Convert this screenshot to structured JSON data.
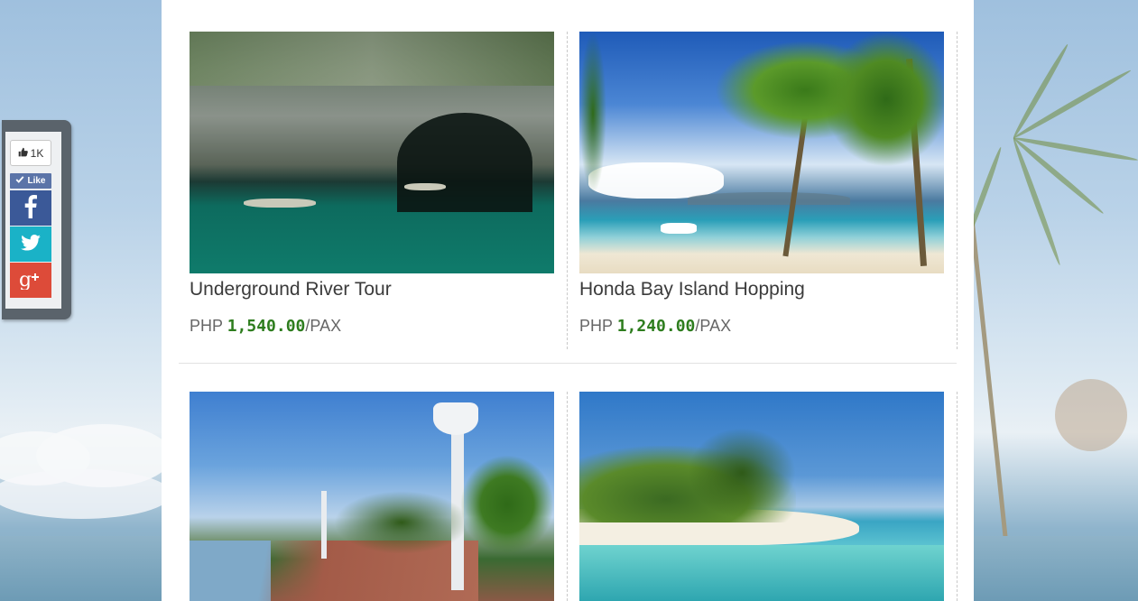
{
  "share_widget": {
    "like_count": "1K",
    "like_label": "Like",
    "buttons": [
      {
        "name": "facebook",
        "color": "#3b5998"
      },
      {
        "name": "twitter",
        "color": "#1ab2c7"
      },
      {
        "name": "google-plus",
        "color": "#dd4b39"
      }
    ]
  },
  "tours": [
    {
      "title": "Underground River Tour",
      "currency": "PHP",
      "amount": "1,540.00",
      "unit": "/PAX"
    },
    {
      "title": "Honda Bay Island Hopping",
      "currency": "PHP",
      "amount": "1,240.00",
      "unit": "/PAX"
    },
    {
      "title": "",
      "currency": "",
      "amount": "",
      "unit": ""
    },
    {
      "title": "",
      "currency": "",
      "amount": "",
      "unit": ""
    }
  ],
  "colors": {
    "price_amount": "#2e7d1e",
    "title_text": "#3b3b3b"
  }
}
